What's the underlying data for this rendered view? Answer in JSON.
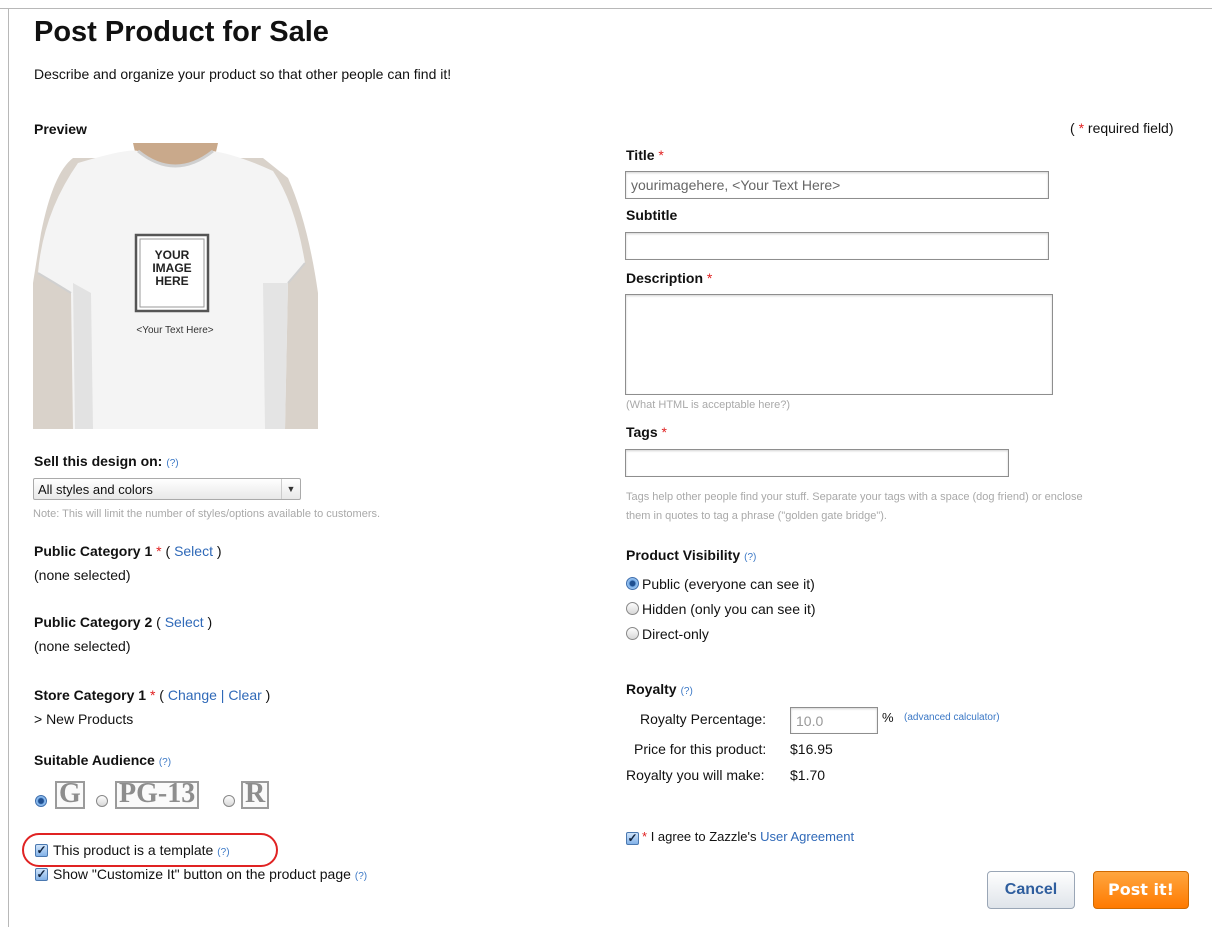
{
  "page": {
    "title": "Post Product for Sale",
    "intro": "Describe and organize your product so that other people can find it!",
    "required_note_open": "(",
    "required_note_star": "*",
    "required_note_text": "required field)"
  },
  "preview": {
    "label": "Preview",
    "image_box_text": "YOUR IMAGE HERE",
    "image_caption": "<Your Text Here>"
  },
  "sell_on": {
    "label": "Sell this design on:",
    "help": "(?)",
    "selected": "All styles and colors",
    "note": "Note: This will limit the number of styles/options available to customers."
  },
  "category1": {
    "label": "Public Category 1",
    "star": "*",
    "open": "(",
    "link": "Select",
    "close": ")",
    "value": "(none selected)"
  },
  "category2": {
    "label": "Public Category 2",
    "open": "(",
    "link": "Select",
    "close": ")",
    "value": "(none selected)"
  },
  "store_category": {
    "label": "Store Category 1",
    "star": "*",
    "open": "(",
    "change_link": "Change",
    "sep": "|",
    "clear_link": "Clear",
    "close": ")",
    "value": "> New Products"
  },
  "audience": {
    "label": "Suitable Audience",
    "help": "(?)",
    "options": [
      "G",
      "PG-13",
      "R"
    ],
    "selected": "G"
  },
  "template_option": {
    "label": "This product is a template",
    "help": "(?)",
    "checked": true
  },
  "customize_option": {
    "label": "Show \"Customize It\" button on the product page",
    "help": "(?)",
    "checked": true
  },
  "title_field": {
    "label": "Title",
    "star": "*",
    "value": "yourimagehere, <Your Text Here>"
  },
  "subtitle_field": {
    "label": "Subtitle",
    "value": ""
  },
  "description_field": {
    "label": "Description",
    "star": "*",
    "hint": "(What HTML is acceptable here?)"
  },
  "tags_field": {
    "label": "Tags",
    "star": "*",
    "value": "",
    "note_line1": "Tags help other people find your stuff. Separate your tags with a space (dog friend) or enclose",
    "note_line2": "them in quotes to tag a phrase (\"golden gate bridge\")."
  },
  "visibility": {
    "label": "Product Visibility",
    "help": "(?)",
    "options": [
      "Public (everyone can see it)",
      "Hidden (only you can see it)",
      "Direct-only"
    ],
    "selected": "Public (everyone can see it)"
  },
  "royalty": {
    "label": "Royalty",
    "help": "(?)",
    "percentage_label": "Royalty Percentage:",
    "percentage_value": "10.0",
    "percent_sign": "%",
    "calculator_link": "(advanced calculator)",
    "price_label": "Price for this product:",
    "price_value": "$16.95",
    "earn_label": "Royalty you will make:",
    "earn_value": "$1.70"
  },
  "agreement": {
    "star": "*",
    "text": "I agree to Zazzle's",
    "link": "User Agreement",
    "checked": true
  },
  "buttons": {
    "cancel": "Cancel",
    "post": "Post it!"
  },
  "colors": {
    "link": "#2f69b8",
    "required": "#e02020",
    "post_button": "#ff8a00",
    "highlight_circle": "#e02323"
  }
}
